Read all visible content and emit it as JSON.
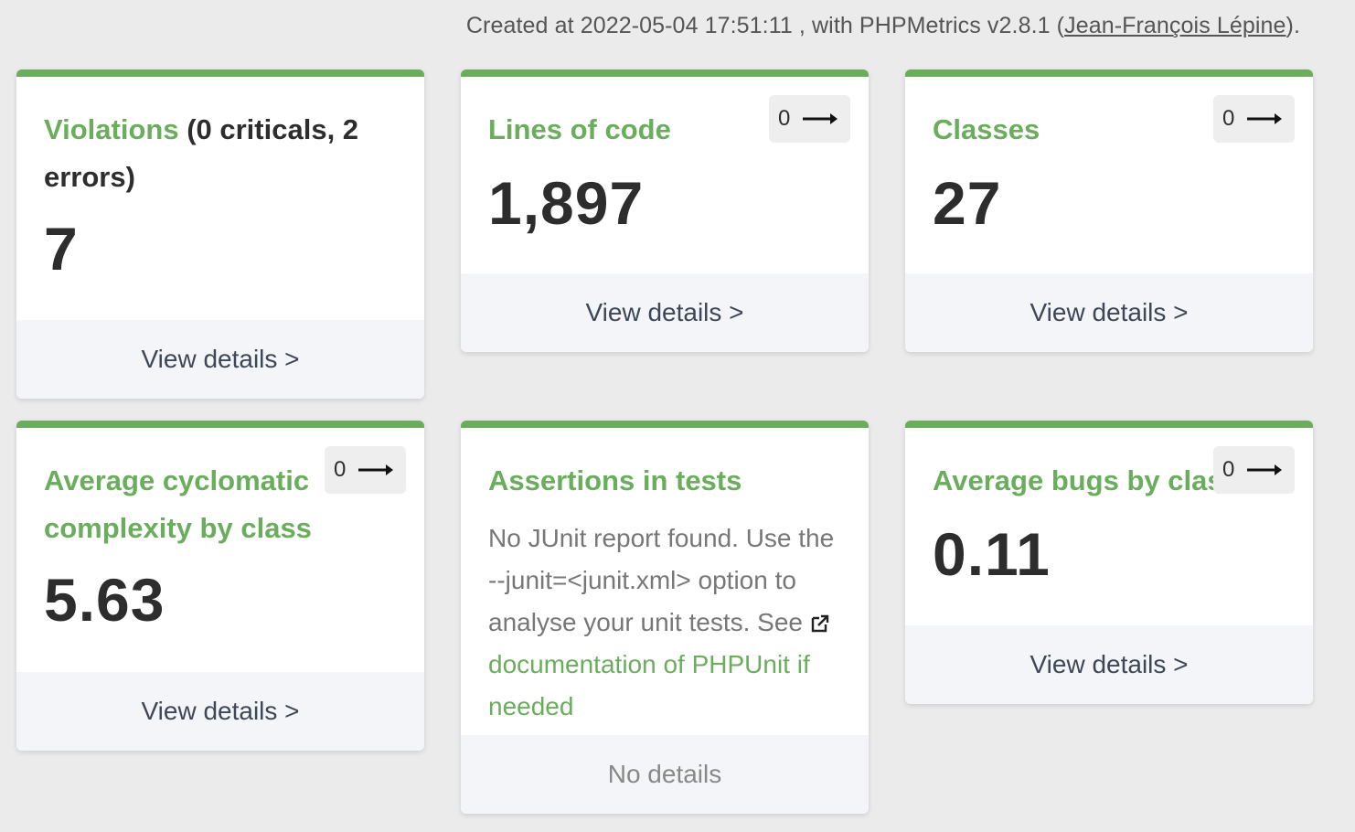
{
  "header": {
    "created_prefix": "Created at 2022-05-04 17:51:11 , with PHPMetrics v2.8.1 (",
    "author": "Jean-François Lépine",
    "created_suffix": ")."
  },
  "colors": {
    "accent": "#6aad5c",
    "text_dark": "#2d2d2d",
    "footer_bg": "#f3f5f8",
    "page_bg": "#ebebeb"
  },
  "cards": {
    "violations": {
      "title": "Violations",
      "extra": "(0 criticals, 2 errors)",
      "value": "7",
      "footer": "View details >"
    },
    "loc": {
      "title": "Lines of code",
      "trend": "0",
      "trend_icon": "arrow-right-icon",
      "value": "1,897",
      "footer": "View details >"
    },
    "classes": {
      "title": "Classes",
      "trend": "0",
      "trend_icon": "arrow-right-icon",
      "value": "27",
      "footer": "View details >"
    },
    "ccn": {
      "title": "Average cyclomatic complexity by class",
      "trend": "0",
      "trend_icon": "arrow-right-icon",
      "value": "5.63",
      "footer": "View details >"
    },
    "assertions": {
      "title": "Assertions in tests",
      "note": "No JUnit report found. Use the --junit=<junit.xml> option to analyse your unit tests. See",
      "link": "documentation of PHPUnit if needed",
      "link_icon": "external-link-icon",
      "footer": "No details"
    },
    "bugs": {
      "title": "Average bugs by class",
      "trend": "0",
      "trend_icon": "arrow-right-icon",
      "value": "0.11",
      "footer": "View details >"
    }
  }
}
